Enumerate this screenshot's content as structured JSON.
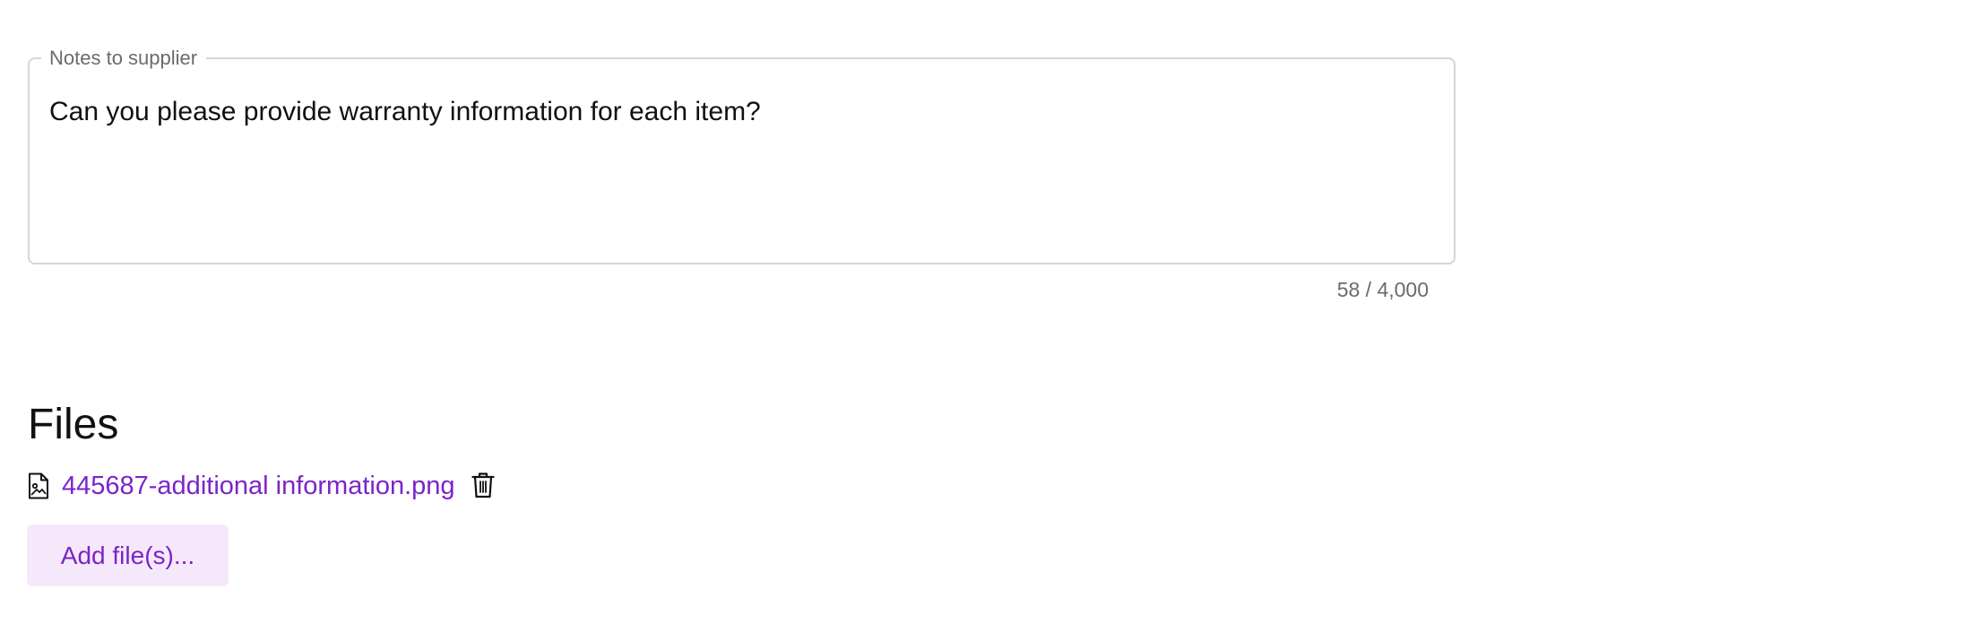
{
  "notes": {
    "legend": "Notes to supplier",
    "value": "Can you please provide warranty information for each item?",
    "counter": "58 / 4,000"
  },
  "files": {
    "heading": "Files",
    "items": [
      {
        "name": "445687-additional information.png",
        "type_icon": "image-file-icon",
        "delete_icon": "trash-icon"
      }
    ],
    "add_button_label": "Add file(s)..."
  },
  "colors": {
    "accent": "#7b24c8",
    "accent_bg": "#f6e8fb",
    "border": "#d6d6d6",
    "muted_text": "#6b6b6b"
  }
}
